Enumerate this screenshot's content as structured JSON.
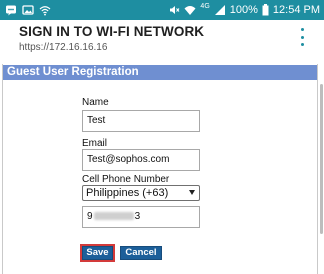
{
  "status_bar": {
    "left_icons": [
      "notification-icon",
      "image-icon",
      "wifi-signal-icon"
    ],
    "network_label": "4G",
    "battery": "100%",
    "time": "12:54 PM"
  },
  "app_bar": {
    "title": "SIGN IN TO WI-FI NETWORK",
    "url": "https://172.16.16.16"
  },
  "form": {
    "section_title": "Guest User Registration",
    "name_label": "Name",
    "name_value": "Test",
    "email_label": "Email",
    "email_value": "Test@sophos.com",
    "phone_label": "Cell Phone Number",
    "country_selected": "Philippines (+63)",
    "phone_prefix": "9",
    "phone_suffix": "3",
    "save_label": "Save",
    "cancel_label": "Cancel"
  },
  "colors": {
    "status_bar": "#1e8ea1",
    "section_header": "#6f8fd1",
    "button": "#1c5f9a",
    "focus_outline": "#d33a3a"
  }
}
